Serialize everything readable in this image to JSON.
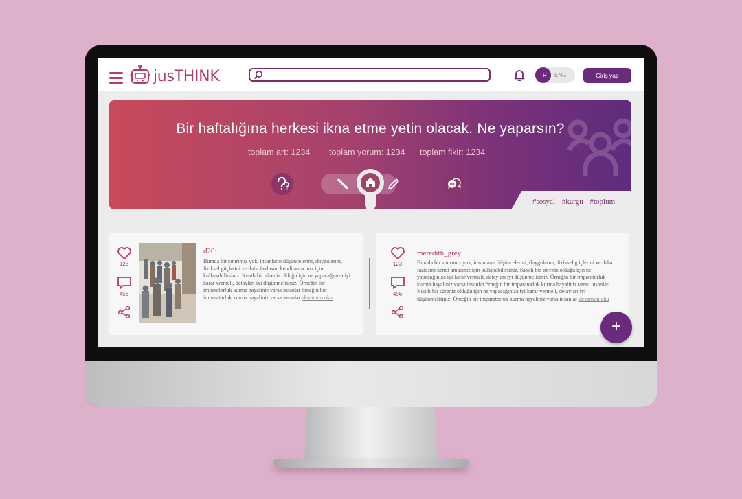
{
  "brand": {
    "name": "jusTHINK"
  },
  "header": {
    "search_placeholder": "",
    "lang_active": "TR",
    "lang_other": "ENG",
    "login_label": "Giriş yap"
  },
  "banner": {
    "question": "Bir haftalığına herkesi ikna etme yetin olacak. Ne yaparsın?",
    "stats": {
      "art": "toplam art: 1234",
      "comment": "toplam yorum: 1234",
      "idea": "toplam fikir: 1234"
    },
    "tags": [
      "#sosyal",
      "#kurgu",
      "#toplum"
    ]
  },
  "posts": [
    {
      "username": "d20:",
      "likes": "123",
      "comments": "456",
      "text": "Burada bir sınırımız yok, insanların düşüncelerini, duygularını, fiziksel güçlerini ve daha fazlasını kendi amacınız için kullanabilirsiniz. Kısıtlı bir süreniz olduğu için ne yapacağınıza iyi karar vermeli, detayları iyi düşünmelisiniz. Örneğin bir imparatorluk kurma hayaliniz varsa insanlar örneğin bir imparatorluk kurma hayaliniz varsa insanlar",
      "more": "devamını oku"
    },
    {
      "username": "meredith_grey",
      "likes": "123",
      "comments": "456",
      "text": "Burada bir sınırımız yok, insanların düşüncelerini, duygularını, fiziksel güçlerini ve daha fazlasını kendi amacınız için kullanabilirsiniz. Kısıtlı bir süreniz olduğu için ne yapacağınıza iyi karar vermeli, detayları iyi düşünmelisiniz. Örneğin bir imparatorluk kurma hayaliniz varsa insanlar örneğin bir imparatorluk kurma hayaliniz varsa insanlar Kısıtlı bir süreniz olduğu için ne yapacağınıza iyi karar vermeli, detayları iyi düşünmelisiniz. Örneğin bir imparatorluk kurma hayaliniz varsa insanlar",
      "more": "devamını oku"
    }
  ],
  "fab": {
    "label": "+"
  },
  "icons": {
    "menu": "hamburger-icon",
    "logo": "robot-icon",
    "search": "search-icon",
    "notifications": "bell-icon",
    "question": "question-icon",
    "draw": "pencil-icon",
    "home": "home-icon",
    "write": "pen-icon",
    "discussion": "chat-bubbles-icon",
    "like": "heart-icon",
    "comment": "comment-icon",
    "share": "share-icon"
  },
  "colors": {
    "brand_pink": "#b83a62",
    "brand_purple": "#6a2b7c",
    "banner_gradient_start": "#c84a5b",
    "banner_gradient_end": "#5e2b7e",
    "background": "#ddb0cc"
  }
}
